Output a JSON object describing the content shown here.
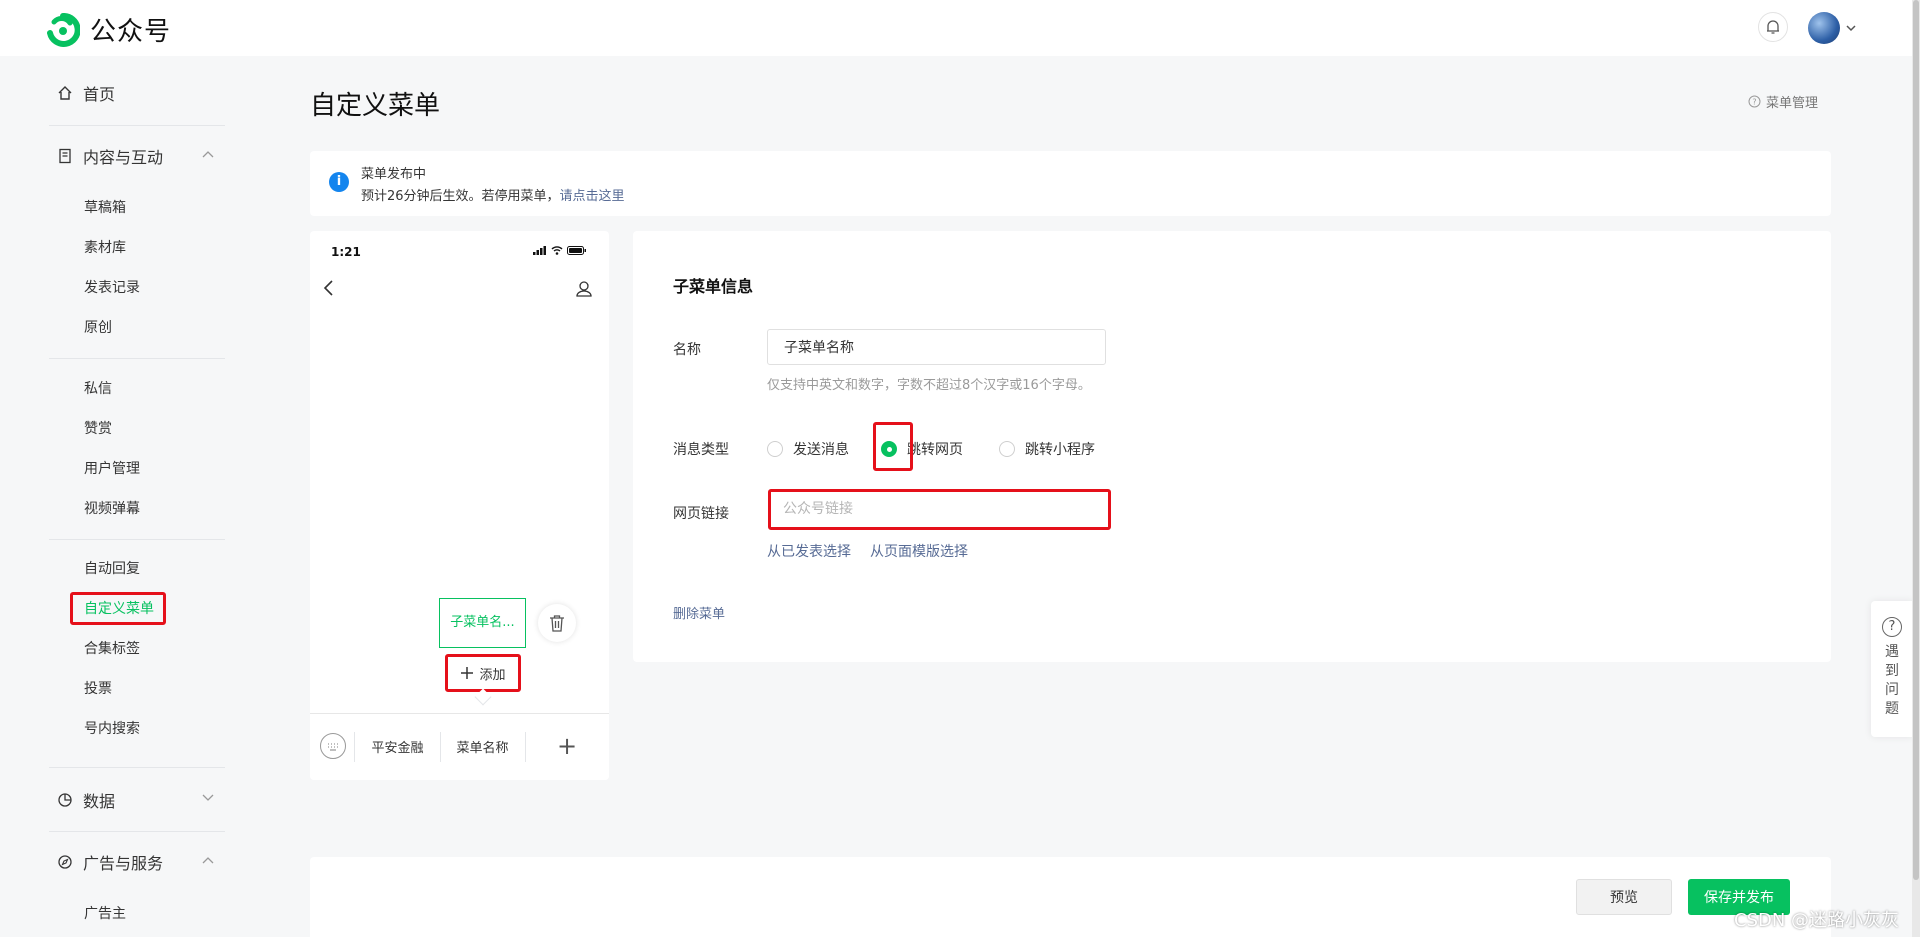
{
  "app": {
    "name": "公众号",
    "brand_color": "#07c160",
    "link_color": "#576b95",
    "highlight_color": "#e5101a"
  },
  "header": {
    "bell_icon": "bell-icon",
    "avatar_icon": "avatar"
  },
  "sidebar": {
    "home": "首页",
    "content_group": "内容与互动",
    "content_items": [
      "草稿箱",
      "素材库",
      "发表记录",
      "原创"
    ],
    "interact_items": [
      "私信",
      "赞赏",
      "用户管理",
      "视频弹幕"
    ],
    "feature_items": [
      "自动回复",
      "自定义菜单",
      "合集标签",
      "投票",
      "号内搜索"
    ],
    "active_item": "自定义菜单",
    "data_group": "数据",
    "ads_group": "广告与服务",
    "ads_items": [
      "广告主"
    ]
  },
  "main": {
    "title": "自定义菜单",
    "help_link": "菜单管理",
    "notice": {
      "title": "菜单发布中",
      "text": "预计26分钟后生效。若停用菜单，",
      "link": "请点击这里"
    }
  },
  "phone": {
    "time": "1:21",
    "submenu_item": "子菜单名...",
    "add_label": "添加",
    "bottom_menus": [
      "平安金融",
      "菜单名称"
    ]
  },
  "form": {
    "title": "子菜单信息",
    "name_label": "名称",
    "name_value": "子菜单名称",
    "name_hint": "仅支持中英文和数字，字数不超过8个汉字或16个字母。",
    "type_label": "消息类型",
    "type_options": [
      "发送消息",
      "跳转网页",
      "跳转小程序"
    ],
    "type_selected": "跳转网页",
    "url_label": "网页链接",
    "url_placeholder": "公众号链接",
    "url_value": "",
    "link_published": "从已发表选择",
    "link_template": "从页面模版选择",
    "delete_label": "删除菜单"
  },
  "actions": {
    "preview": "预览",
    "save_publish": "保存并发布"
  },
  "help_widget": {
    "text": "遇到问题"
  },
  "watermark": "CSDN @迷路小灰灰"
}
